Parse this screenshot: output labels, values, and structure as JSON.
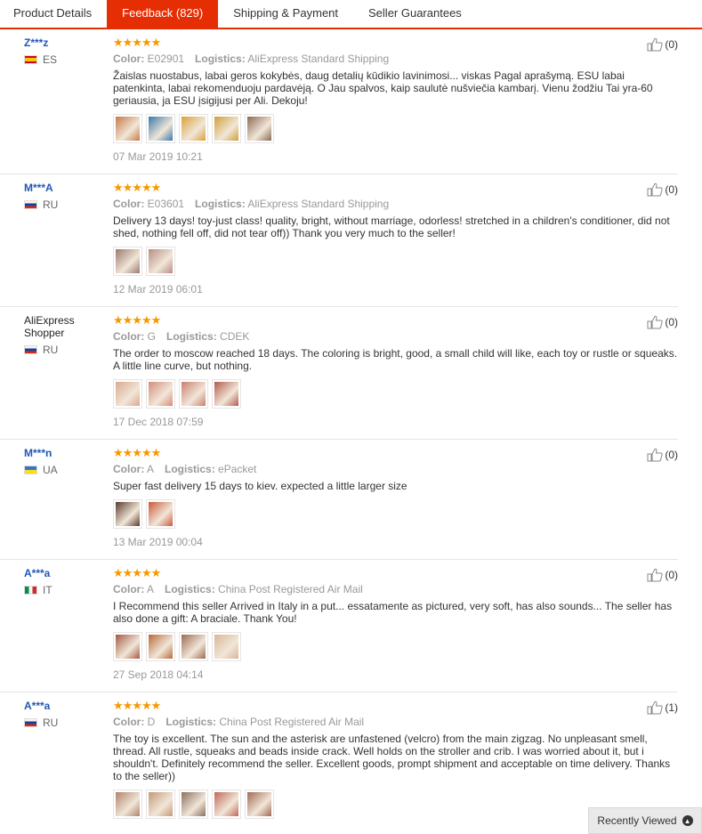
{
  "tabs": [
    {
      "label": "Product Details",
      "active": false
    },
    {
      "label": "Feedback (829)",
      "active": true
    },
    {
      "label": "Shipping & Payment",
      "active": false
    },
    {
      "label": "Seller Guarantees",
      "active": false
    }
  ],
  "labels": {
    "color": "Color:",
    "logistics": "Logistics:"
  },
  "reviews": [
    {
      "user": "Z***z",
      "country": "ES",
      "stars": "★★★★★",
      "rating": 5,
      "color": "E02901",
      "logistics": "AliExpress Standard Shipping",
      "text": "Žaislas nuostabus, labai geros kokybės, daug detalių kūdikio lavinimosi... viskas Pagal aprašymą. ESU labai patenkinta, labai rekomenduoju pardavėją. O Jau spalvos, kaip saulutė nušviečia kambarį. Vienu žodžiu Tai yra-60 geriausia, ja ESU įsigijusi per Ali. Dekoju!",
      "photos": [
        "#c7794a",
        "#3b78a8",
        "#d8a23a",
        "#cfa03c",
        "#8a6a55"
      ],
      "date": "07 Mar 2019 10:21",
      "helpful": "(0)"
    },
    {
      "user": "M***A",
      "country": "RU",
      "stars": "★★★★★",
      "rating": 5,
      "color": "E03601",
      "logistics": "AliExpress Standard Shipping",
      "text": "Delivery 13 days! toy-just class! quality, bright, without marriage, odorless! stretched in a children's conditioner, did not shed, nothing fell off, did not tear off)) Thank you very much to the seller!",
      "photos": [
        "#9a7a6c",
        "#b98c82"
      ],
      "date": "12 Mar 2019 06:01",
      "helpful": "(0)"
    },
    {
      "user": "AliExpress Shopper",
      "country": "RU",
      "stars": "★★★★★",
      "rating": 5,
      "color": "G",
      "logistics": "CDEK",
      "text": "The order to moscow reached 18 days. The coloring is bright, good, a small child will like, each toy or rustle or squeaks. A little line curve, but nothing.",
      "photos": [
        "#d9a98c",
        "#d48c7a",
        "#c9806e",
        "#b35a4a"
      ],
      "date": "17 Dec 2018 07:59",
      "helpful": "(0)"
    },
    {
      "user": "M***n",
      "country": "UA",
      "stars": "★★★★★",
      "rating": 5,
      "color": "A",
      "logistics": "ePacket",
      "text": "Super fast delivery 15 days to kiev. expected a little larger size",
      "photos": [
        "#5a3b2c",
        "#c85a3a"
      ],
      "date": "13 Mar 2019 00:04",
      "helpful": "(0)"
    },
    {
      "user": "A***a",
      "country": "IT",
      "stars": "★★★★★",
      "rating": 5,
      "color": "A",
      "logistics": "China Post Registered Air Mail",
      "text": "I Recommend this seller Arrived in Italy in a put... essatamente as pictured, very soft, has also sounds... The seller has also done a gift: A braciale. Thank You!",
      "photos": [
        "#a35a44",
        "#b86a3c",
        "#9c6b52",
        "#d8b79a"
      ],
      "date": "27 Sep 2018 04:14",
      "helpful": "(0)"
    },
    {
      "user": "A***a",
      "country": "RU",
      "stars": "★★★★★",
      "rating": 5,
      "color": "D",
      "logistics": "China Post Registered Air Mail",
      "text": "The toy is excellent. The sun and the asterisk are unfastened (velcro) from the main zigzag. No unpleasant smell, thread. All rustle, squeaks and beads inside crack. Well holds on the stroller and crib. I was worried about it, but i shouldn't. Definitely recommend the seller. Excellent goods, prompt shipment and acceptable on time delivery. Thanks to the seller))",
      "photos": [
        "#b0826a",
        "#c49a76",
        "#8c6e5e",
        "#c0685a",
        "#a06a52"
      ],
      "date": "",
      "helpful": "(1)"
    }
  ],
  "recently_viewed": "Recently Viewed",
  "colors": {
    "accent": "#e62e04",
    "star": "#f79800",
    "user_link": "#2157b5"
  }
}
